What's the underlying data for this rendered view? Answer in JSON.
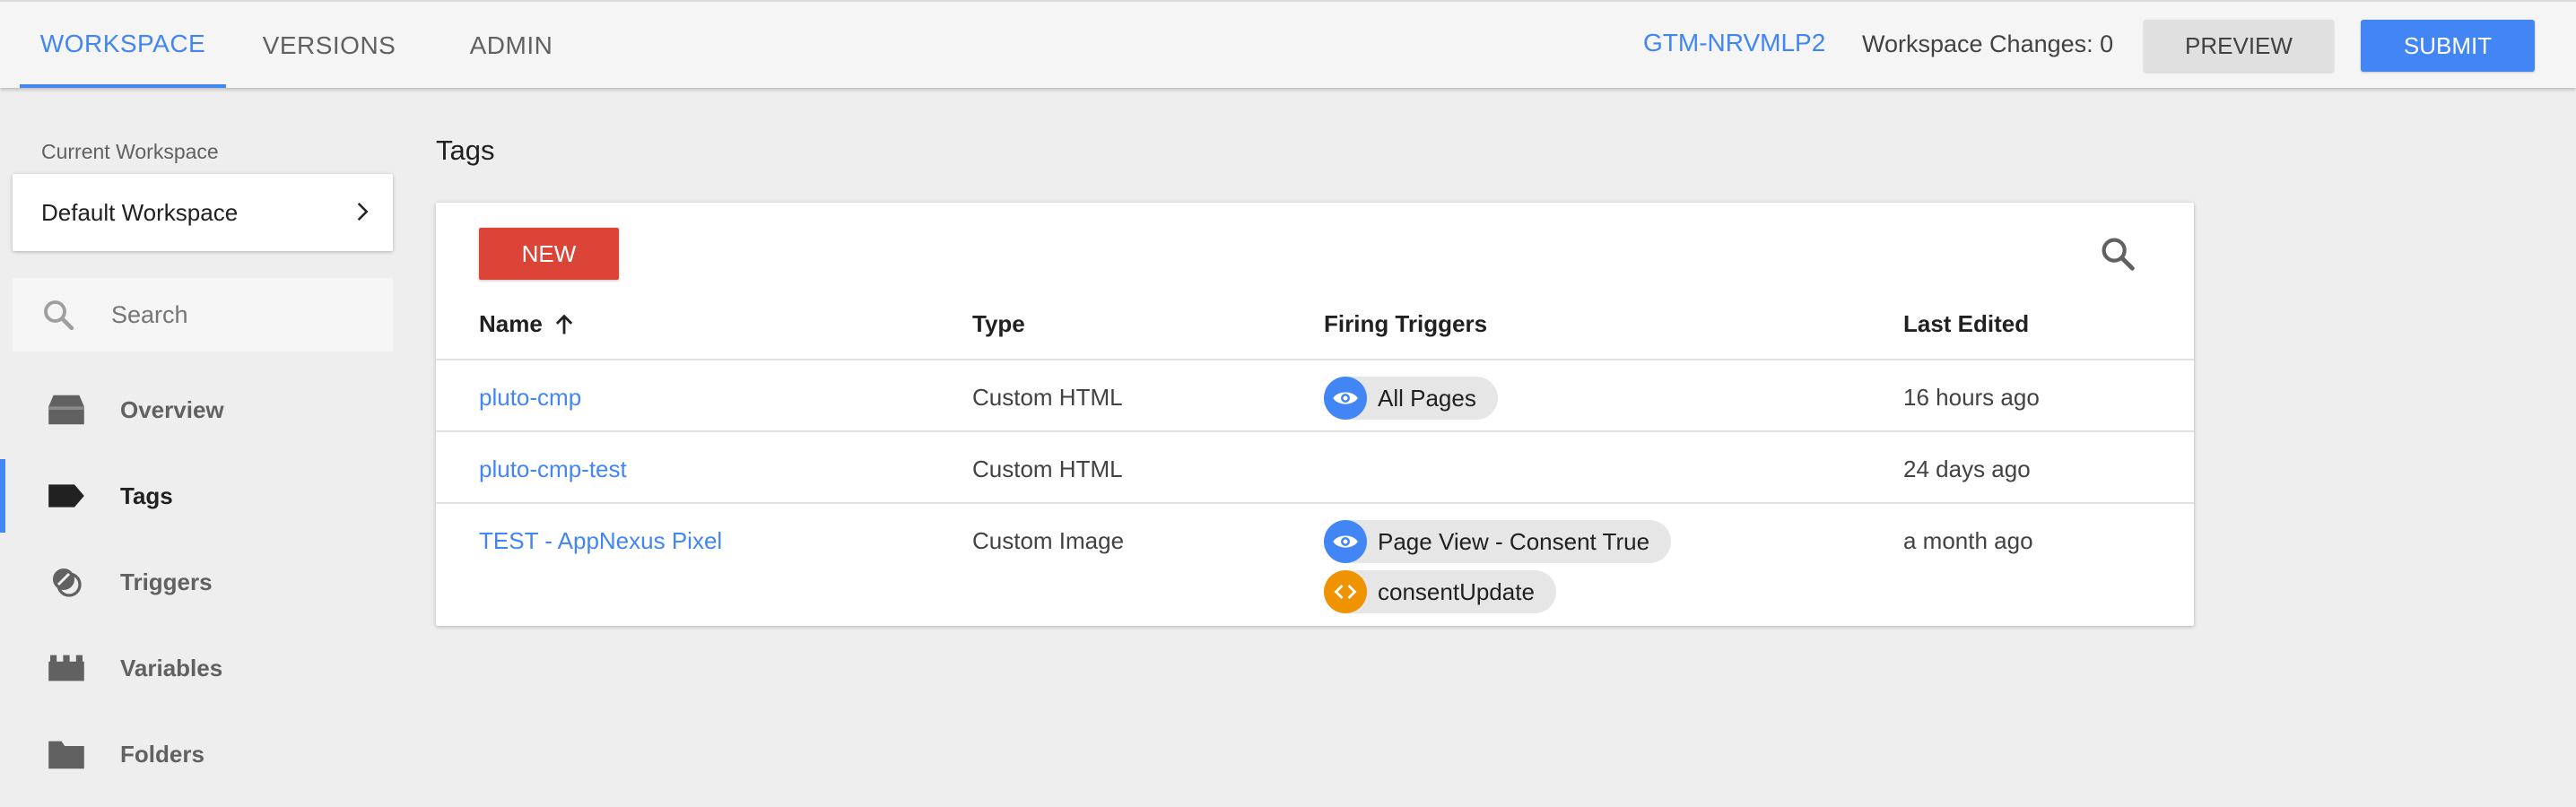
{
  "header": {
    "tabs": [
      {
        "label": "WORKSPACE",
        "active": true
      },
      {
        "label": "VERSIONS",
        "active": false
      },
      {
        "label": "ADMIN",
        "active": false
      }
    ],
    "container_id": "GTM-NRVMLP2",
    "workspace_changes": "Workspace Changes: 0",
    "preview_label": "PREVIEW",
    "submit_label": "SUBMIT"
  },
  "sidebar": {
    "current_workspace_label": "Current Workspace",
    "workspace_name": "Default Workspace",
    "search_placeholder": "Search",
    "items": [
      {
        "label": "Overview",
        "icon": "overview-icon",
        "active": false
      },
      {
        "label": "Tags",
        "icon": "tag-icon",
        "active": true
      },
      {
        "label": "Triggers",
        "icon": "trigger-icon",
        "active": false
      },
      {
        "label": "Variables",
        "icon": "variables-icon",
        "active": false
      },
      {
        "label": "Folders",
        "icon": "folder-icon",
        "active": false
      }
    ]
  },
  "main": {
    "title": "Tags",
    "new_label": "NEW",
    "columns": [
      "Name",
      "Type",
      "Firing Triggers",
      "Last Edited"
    ],
    "rows": [
      {
        "name": "pluto-cmp",
        "type": "Custom HTML",
        "triggers": [
          {
            "label": "All Pages",
            "icon": "eye-icon",
            "color": "#4285f4"
          }
        ],
        "last_edited": "16 hours ago"
      },
      {
        "name": "pluto-cmp-test",
        "type": "Custom HTML",
        "triggers": [],
        "last_edited": "24 days ago"
      },
      {
        "name": "TEST - AppNexus Pixel",
        "type": "Custom Image",
        "triggers": [
          {
            "label": "Page View - Consent True",
            "icon": "eye-icon",
            "color": "#4285f4"
          },
          {
            "label": "consentUpdate",
            "icon": "code-icon",
            "color": "#f09300"
          }
        ],
        "last_edited": "a month ago"
      }
    ]
  },
  "colors": {
    "accent": "#4285f4",
    "new_button": "#db4437",
    "custom_event": "#f09300",
    "background": "#eeeeee"
  }
}
